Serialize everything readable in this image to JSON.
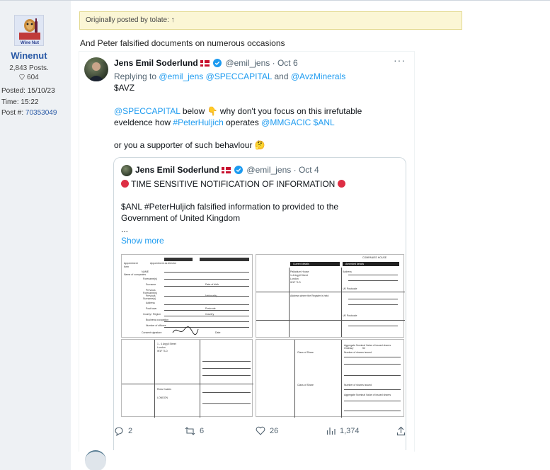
{
  "user": {
    "username": "Winenut",
    "avatar_caption": "Wine Nut",
    "posts": "2,843 Posts.",
    "likes": "604",
    "posted_label": "Posted:",
    "posted_value": "15/10/23",
    "time_label": "Time:",
    "time_value": "15:22",
    "post_label": "Post #:",
    "post_value": "70353049"
  },
  "post": {
    "quote_attribution": "Originally posted by tolate: ↑",
    "text": "And Peter falsified documents on numerous occasions"
  },
  "tweet": {
    "author_name": "Jens Emil Soderlund",
    "handle": "@emil_jens",
    "separator": "·",
    "date": "Oct 6",
    "more": "···",
    "replying_prefix": "Replying to",
    "replying_to": [
      "@emil_jens",
      "@SPECCAPITAL",
      "@AvzMinerals"
    ],
    "replying_and": "and",
    "cashtag_avz": "$AVZ",
    "line1_mention": "@SPECCAPITAL",
    "line1_text": " below ",
    "line1_text2": " why don't you focus on this irrefutable",
    "line2_text": "eveldence how ",
    "line2_hashtag": "#PeterHuljich",
    "line2_text2": " operates ",
    "line2_mention": "@MMGACIC",
    "line2_cashtag": "$ANL",
    "line3_text": "or you a supporter of such behavlour ",
    "pointing_emoji": "👇",
    "thinking_emoji": "🤔"
  },
  "quoted": {
    "author_name": "Jens Emil Soderlund",
    "handle": "@emil_jens",
    "separator": "·",
    "date": "Oct 4",
    "headline": "TIME SENSITIVE NOTIFICATION OF INFORMATION",
    "body1": "$ANL #PeterHuljich falsified information to provided to the",
    "body2": "Government of United Kingdom",
    "ellipsis": "...",
    "show_more": "Show more"
  },
  "document": {
    "labels_left": [
      "Appointment",
      "Appointment as director",
      "form",
      "NAME",
      "Name of companies",
      "Forename(s)",
      "Surname",
      "Previous",
      "Forename(s)",
      "Previous",
      "Surname(s)",
      "Address",
      "Post town",
      "County / Region",
      "Postcode",
      "Country",
      "Consent signature",
      "Date",
      "Date of birth",
      "Nationality",
      "Business occupation",
      "Number of officers",
      "Other directorships",
      "1 - 4 Argyll Street",
      "London",
      "W1F 7LD",
      "Ross Coates",
      "LONDON",
      "COMPANIES HOUSE"
    ],
    "labels_right": [
      "Current details",
      "Amended details",
      "Address",
      "UK Postcode",
      "Palladium House",
      "1-4 Argyll Street",
      "London",
      "W1F 7LD",
      "Address where the Register is held",
      "UK Postcode",
      "Class of Share",
      "Number of shares issued",
      "Aggregate Nominal Value of issued shares",
      "Ordinary",
      "52",
      "Class of Share",
      "Number of shares issued",
      "Aggregate Nominal Value of issued shares"
    ]
  },
  "actions": {
    "replies": "2",
    "retweets": "6",
    "likes": "26",
    "views": "1,374"
  }
}
